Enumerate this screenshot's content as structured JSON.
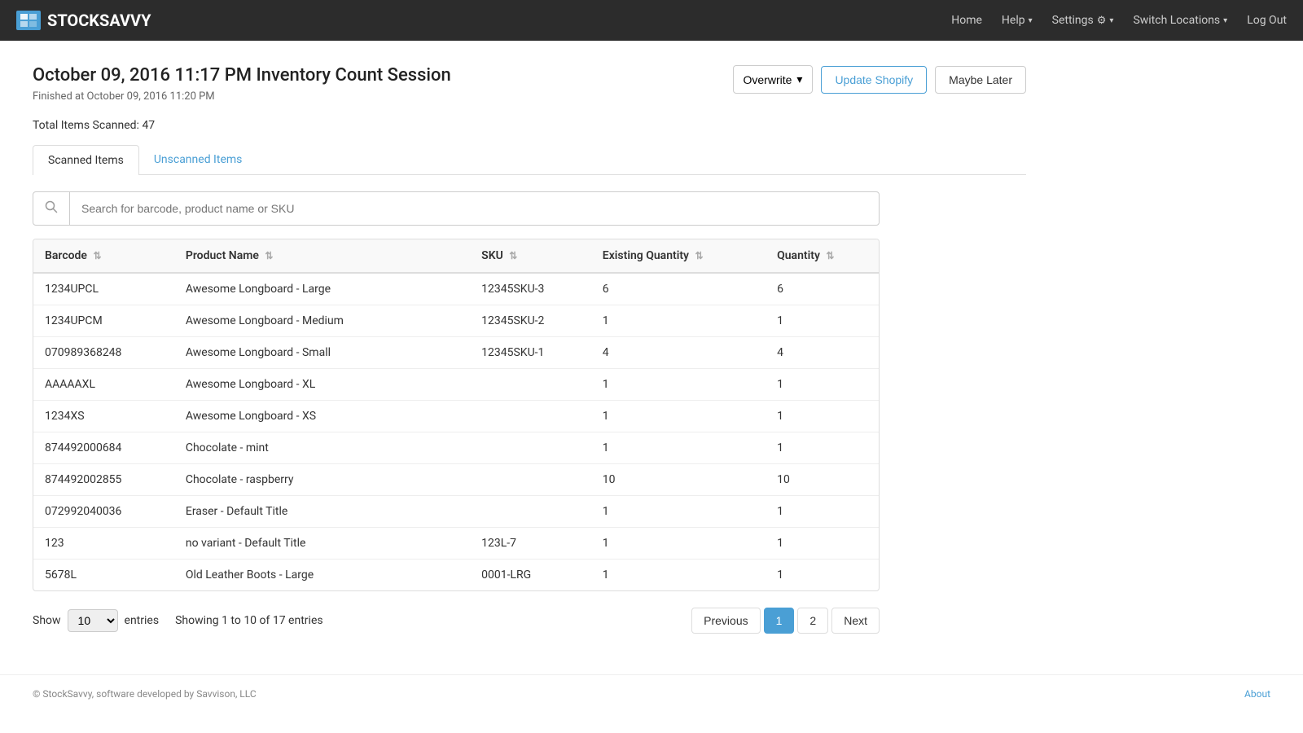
{
  "navbar": {
    "brand": "STOCKSAVVY",
    "brand_icon": "◼",
    "nav_items": [
      {
        "label": "Home",
        "type": "link"
      },
      {
        "label": "Help",
        "type": "dropdown"
      },
      {
        "label": "Settings",
        "type": "dropdown",
        "icon": "⚙"
      },
      {
        "label": "Switch Locations",
        "type": "dropdown"
      },
      {
        "label": "Log Out",
        "type": "link"
      }
    ]
  },
  "page": {
    "title": "October 09, 2016 11:17 PM Inventory Count Session",
    "subtitle": "Finished at October 09, 2016 11:20 PM",
    "total_items_label": "Total Items Scanned:",
    "total_items_value": "47"
  },
  "actions": {
    "overwrite_label": "Overwrite",
    "update_shopify_label": "Update Shopify",
    "maybe_later_label": "Maybe Later"
  },
  "tabs": [
    {
      "label": "Scanned Items",
      "active": true
    },
    {
      "label": "Unscanned Items",
      "active": false
    }
  ],
  "search": {
    "placeholder": "Search for barcode, product name or SKU"
  },
  "table": {
    "columns": [
      {
        "label": "Barcode",
        "sortable": true
      },
      {
        "label": "Product Name",
        "sortable": true
      },
      {
        "label": "SKU",
        "sortable": true
      },
      {
        "label": "Existing Quantity",
        "sortable": true
      },
      {
        "label": "Quantity",
        "sortable": true
      }
    ],
    "rows": [
      {
        "barcode": "1234UPCL",
        "product_name": "Awesome Longboard - Large",
        "sku": "12345SKU-3",
        "existing_qty": "6",
        "qty": "6"
      },
      {
        "barcode": "1234UPCM",
        "product_name": "Awesome Longboard - Medium",
        "sku": "12345SKU-2",
        "existing_qty": "1",
        "qty": "1"
      },
      {
        "barcode": "070989368248",
        "product_name": "Awesome Longboard - Small",
        "sku": "12345SKU-1",
        "existing_qty": "4",
        "qty": "4"
      },
      {
        "barcode": "AAAAAXL",
        "product_name": "Awesome Longboard - XL",
        "sku": "",
        "existing_qty": "1",
        "qty": "1"
      },
      {
        "barcode": "1234XS",
        "product_name": "Awesome Longboard - XS",
        "sku": "",
        "existing_qty": "1",
        "qty": "1"
      },
      {
        "barcode": "874492000684",
        "product_name": "Chocolate - mint",
        "sku": "",
        "existing_qty": "1",
        "qty": "1"
      },
      {
        "barcode": "874492002855",
        "product_name": "Chocolate - raspberry",
        "sku": "",
        "existing_qty": "10",
        "qty": "10"
      },
      {
        "barcode": "072992040036",
        "product_name": "Eraser - Default Title",
        "sku": "",
        "existing_qty": "1",
        "qty": "1"
      },
      {
        "barcode": "123",
        "product_name": "no variant - Default Title",
        "sku": "123L-7",
        "existing_qty": "1",
        "qty": "1"
      },
      {
        "barcode": "5678L",
        "product_name": "Old Leather Boots - Large",
        "sku": "0001-LRG",
        "existing_qty": "1",
        "qty": "1"
      }
    ]
  },
  "pagination": {
    "show_label": "Show",
    "entries_label": "entries",
    "show_value": "10",
    "showing_text": "Showing 1 to 10 of 17 entries",
    "previous_label": "Previous",
    "next_label": "Next",
    "pages": [
      "1",
      "2"
    ],
    "active_page": "1"
  },
  "footer": {
    "copyright": "© StockSavvy, software developed by Savvison, LLC",
    "about_label": "About"
  },
  "colors": {
    "primary": "#4a9fd5",
    "navbar_bg": "#2c2c2c"
  }
}
